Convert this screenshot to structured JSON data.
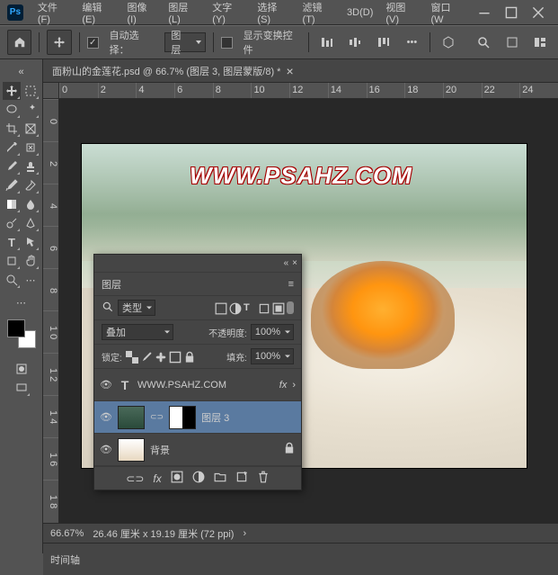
{
  "app": {
    "logo": "Ps"
  },
  "menu": {
    "file": "文件(F)",
    "edit": "编辑(E)",
    "image": "图像(I)",
    "layer": "图层(L)",
    "type": "文字(Y)",
    "select": "选择(S)",
    "filter": "滤镜(T)",
    "threed": "3D(D)",
    "view": "视图(V)",
    "window": "窗口(W"
  },
  "optbar": {
    "autoselect": "自动选择：",
    "layer": "图层",
    "showtransform": "显示变换控件"
  },
  "doc": {
    "tab": "面粉山的金莲花.psd @ 66.7% (图层 3, 图层蒙版/8) *"
  },
  "ruler_h": [
    "0",
    "2",
    "4",
    "6",
    "8",
    "10",
    "12",
    "14",
    "16",
    "18",
    "20",
    "22",
    "24"
  ],
  "ruler_v": [
    "0",
    "2",
    "4",
    "6",
    "8",
    "1\n0",
    "1\n2",
    "1\n4",
    "1\n6",
    "1\n8"
  ],
  "watermark": "WWW.PSAHZ.COM",
  "panel": {
    "title": "图层",
    "filter_label": "类型",
    "blend": "叠加",
    "opacity_label": "不透明度:",
    "opacity": "100%",
    "lock_label": "锁定:",
    "fill_label": "填充:",
    "fill": "100%",
    "layers": [
      {
        "name": "WWW.PSAHZ.COM",
        "type": "T",
        "fx": "fx"
      },
      {
        "name": "图层 3",
        "type": "img"
      },
      {
        "name": "背景",
        "type": "img"
      }
    ]
  },
  "status": {
    "zoom": "66.67%",
    "dims": "26.46 厘米 x 19.19 厘米 (72 ppi)"
  },
  "timeline": {
    "label": "时间轴"
  }
}
